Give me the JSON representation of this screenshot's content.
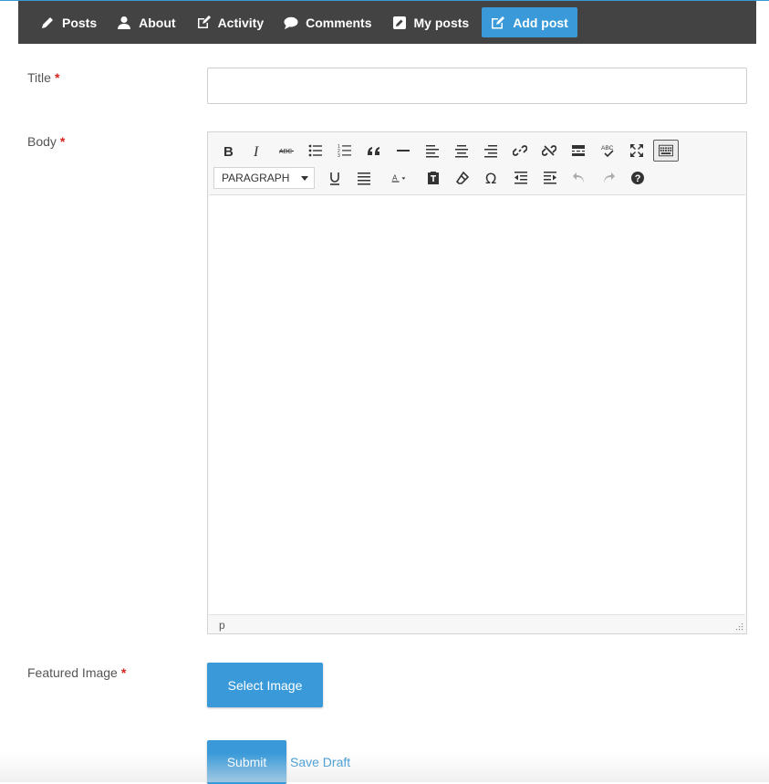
{
  "nav": {
    "items": [
      {
        "label": "Posts",
        "icon": "pencil-icon"
      },
      {
        "label": "About",
        "icon": "user-icon"
      },
      {
        "label": "Activity",
        "icon": "edit-icon"
      },
      {
        "label": "Comments",
        "icon": "comment-icon"
      },
      {
        "label": "My posts",
        "icon": "pencil-square-icon"
      },
      {
        "label": "Add post",
        "icon": "edit-icon",
        "active": true
      }
    ]
  },
  "form": {
    "title_label": "Title",
    "body_label": "Body",
    "featured_label": "Featured Image",
    "required_mark": "*",
    "title_value": "",
    "title_placeholder": ""
  },
  "editor": {
    "format_value": "PARAGRAPH",
    "status_path": "p",
    "toolbar_row1": [
      "bold",
      "italic",
      "strikethrough",
      "bullet-list",
      "numbered-list",
      "blockquote",
      "horizontal-rule",
      "align-left",
      "align-center",
      "align-right",
      "link",
      "unlink",
      "read-more",
      "spellcheck",
      "fullscreen",
      "toolbar-toggle"
    ],
    "toolbar_row2": [
      "format-select",
      "underline",
      "justify",
      "text-color",
      "paste-as-text",
      "clear-formatting",
      "special-character",
      "outdent",
      "indent",
      "undo",
      "redo",
      "help"
    ]
  },
  "buttons": {
    "select_image": "Select Image",
    "submit": "Submit",
    "save_draft": "Save Draft"
  },
  "colors": {
    "navbar": "#434343",
    "accent": "#3a9ad9",
    "required": "#d9231d",
    "link": "#2a8fd1"
  }
}
